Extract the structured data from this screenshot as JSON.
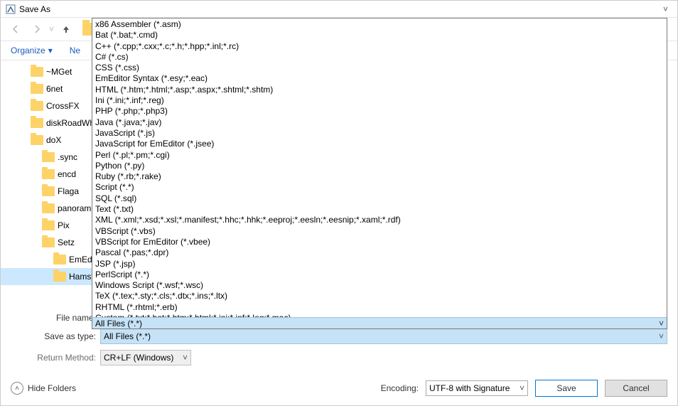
{
  "window": {
    "title": "Save As"
  },
  "toolbar": {
    "organize": "Organize",
    "new_prefix": "Ne"
  },
  "tree": {
    "items": [
      {
        "label": "~MGet",
        "depth": 0
      },
      {
        "label": "6net",
        "depth": 0
      },
      {
        "label": "CrossFX",
        "depth": 0
      },
      {
        "label": "diskRoadWh",
        "depth": 0
      },
      {
        "label": "doX",
        "depth": 0
      },
      {
        "label": ".sync",
        "depth": 1
      },
      {
        "label": "encd",
        "depth": 1
      },
      {
        "label": "Flaga",
        "depth": 1
      },
      {
        "label": "panoramas",
        "depth": 1
      },
      {
        "label": "Pix",
        "depth": 1
      },
      {
        "label": "Setz",
        "depth": 1
      },
      {
        "label": "EmEd",
        "depth": 2
      },
      {
        "label": "Hamstr",
        "depth": 2,
        "selected": true
      }
    ]
  },
  "file_types": {
    "options": [
      "x86 Assembler (*.asm)",
      "Bat (*.bat;*.cmd)",
      "C++ (*.cpp;*.cxx;*.c;*.h;*.hpp;*.inl;*.rc)",
      "C# (*.cs)",
      "CSS (*.css)",
      "EmEditor Syntax (*.esy;*.eac)",
      "HTML (*.htm;*.html;*.asp;*.aspx;*.shtml;*.shtm)",
      "Ini (*.ini;*.inf;*.reg)",
      "PHP (*.php;*.php3)",
      "Java (*.java;*.jav)",
      "JavaScript (*.js)",
      "JavaScript for EmEditor (*.jsee)",
      "Perl (*.pl;*.pm;*.cgi)",
      "Python (*.py)",
      "Ruby (*.rb;*.rake)",
      "Script (*.*)",
      "SQL (*.sql)",
      "Text (*.txt)",
      "XML (*.xml;*.xsd;*.xsl;*.manifest;*.hhc;*.hhk;*.eeproj;*.eesln;*.eesnip;*.xaml;*.rdf)",
      "VBScript (*.vbs)",
      "VBScript for EmEditor (*.vbee)",
      "Pascal (*.pas;*.dpr)",
      "JSP (*.jsp)",
      "PerlScript (*.*)",
      "Windows Script (*.wsf;*.wsc)",
      "TeX (*.tex;*.sty;*.cls;*.dtx;*.ins;*.ltx)",
      "RHTML (*.rhtml;*.erb)",
      "Custom (*.txt;*.bat;*.htm;*.html;*.ini;*.inf;*.log;*.mac)"
    ],
    "highlighted": "All Files (*.*)",
    "selected": "All Files (*.*)"
  },
  "labels": {
    "file_name": "File name:",
    "save_as_type": "Save as type:",
    "return_method": "Return Method:",
    "hide_folders": "Hide Folders",
    "encoding": "Encoding:"
  },
  "values": {
    "file_name": "",
    "return_method": "CR+LF (Windows)",
    "encoding": "UTF-8 with Signature"
  },
  "buttons": {
    "save": "Save",
    "cancel": "Cancel"
  }
}
